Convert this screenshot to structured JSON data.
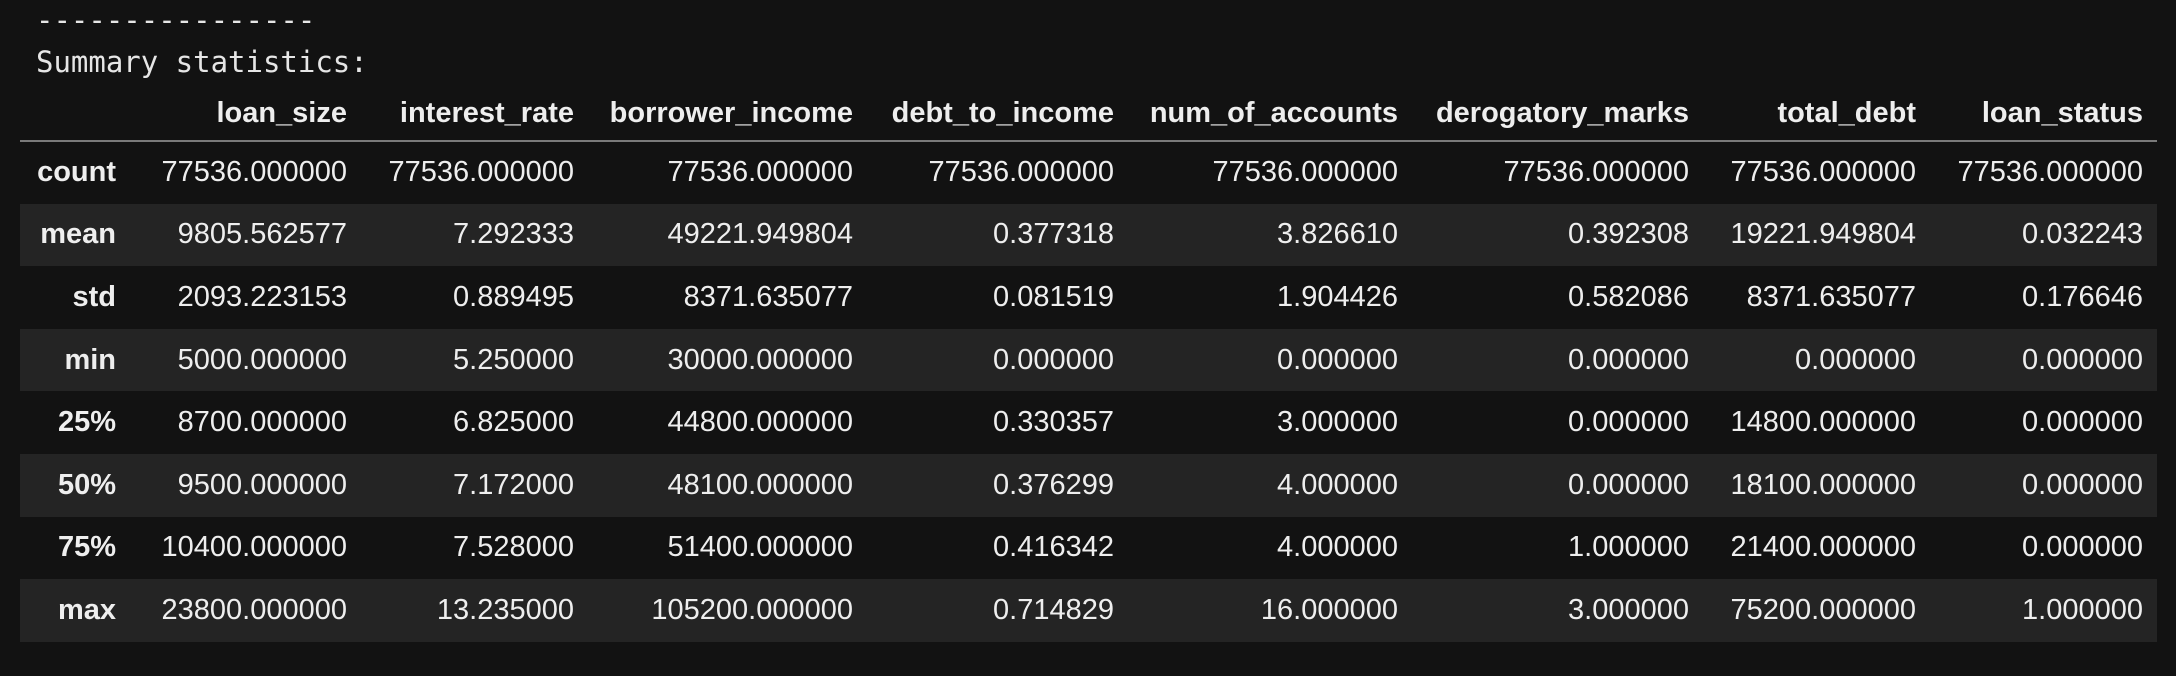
{
  "output": {
    "divider": "----------------",
    "summary_label": "Summary statistics:"
  },
  "table": {
    "columns": [
      "",
      "loan_size",
      "interest_rate",
      "borrower_income",
      "debt_to_income",
      "num_of_accounts",
      "derogatory_marks",
      "total_debt",
      "loan_status"
    ],
    "rows": [
      {
        "stat": "count",
        "values": [
          "77536.000000",
          "77536.000000",
          "77536.000000",
          "77536.000000",
          "77536.000000",
          "77536.000000",
          "77536.000000",
          "77536.000000"
        ]
      },
      {
        "stat": "mean",
        "values": [
          "9805.562577",
          "7.292333",
          "49221.949804",
          "0.377318",
          "3.826610",
          "0.392308",
          "19221.949804",
          "0.032243"
        ]
      },
      {
        "stat": "std",
        "values": [
          "2093.223153",
          "0.889495",
          "8371.635077",
          "0.081519",
          "1.904426",
          "0.582086",
          "8371.635077",
          "0.176646"
        ]
      },
      {
        "stat": "min",
        "values": [
          "5000.000000",
          "5.250000",
          "30000.000000",
          "0.000000",
          "0.000000",
          "0.000000",
          "0.000000",
          "0.000000"
        ]
      },
      {
        "stat": "25%",
        "values": [
          "8700.000000",
          "6.825000",
          "44800.000000",
          "0.330357",
          "3.000000",
          "0.000000",
          "14800.000000",
          "0.000000"
        ]
      },
      {
        "stat": "50%",
        "values": [
          "9500.000000",
          "7.172000",
          "48100.000000",
          "0.376299",
          "4.000000",
          "0.000000",
          "18100.000000",
          "0.000000"
        ]
      },
      {
        "stat": "75%",
        "values": [
          "10400.000000",
          "7.528000",
          "51400.000000",
          "0.416342",
          "4.000000",
          "1.000000",
          "21400.000000",
          "0.000000"
        ]
      },
      {
        "stat": "max",
        "values": [
          "23800.000000",
          "13.235000",
          "105200.000000",
          "0.714829",
          "16.000000",
          "3.000000",
          "75200.000000",
          "1.000000"
        ]
      }
    ]
  },
  "colors": {
    "background": "#121212",
    "stripe": "#242424",
    "text": "#eeeeee",
    "header_rule": "#7a7a7a"
  }
}
